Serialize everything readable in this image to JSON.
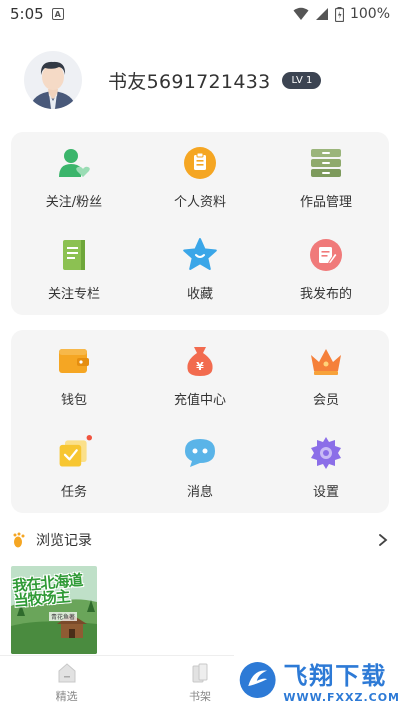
{
  "status_bar": {
    "time": "5:05",
    "battery_percent": "100%"
  },
  "profile": {
    "username": "书友5691721433",
    "level": "LV 1"
  },
  "panel_one": {
    "items": [
      {
        "label": "关注/粉丝",
        "icon": "follow-fans-icon",
        "color": "#3bb56b"
      },
      {
        "label": "个人资料",
        "icon": "profile-clipboard-icon",
        "color": "#f5a623"
      },
      {
        "label": "作品管理",
        "icon": "works-drawer-icon",
        "color": "#8faa6c"
      },
      {
        "label": "关注专栏",
        "icon": "column-notebook-icon",
        "color": "#8cc152"
      },
      {
        "label": "收藏",
        "icon": "star-icon",
        "color": "#3aa6e8"
      },
      {
        "label": "我发布的",
        "icon": "published-icon",
        "color": "#f07a7a"
      }
    ]
  },
  "panel_two": {
    "items": [
      {
        "label": "钱包",
        "icon": "wallet-icon",
        "color": "#f5a623"
      },
      {
        "label": "充值中心",
        "icon": "money-bag-icon",
        "color": "#f26b4f"
      },
      {
        "label": "会员",
        "icon": "crown-icon",
        "color": "#f5803a"
      },
      {
        "label": "任务",
        "icon": "task-icon",
        "color": "#f7c631"
      },
      {
        "label": "消息",
        "icon": "message-bubble-icon",
        "color": "#5ab4e8"
      },
      {
        "label": "设置",
        "icon": "gear-icon",
        "color": "#8b6ee8"
      }
    ]
  },
  "history": {
    "title": "浏览记录",
    "book": {
      "cover_title": "我在北海道\n当牧场主",
      "cover_author": "青花鱼著"
    }
  },
  "bottom_nav": {
    "items": [
      {
        "label": "精选",
        "icon": "home-icon"
      },
      {
        "label": "书架",
        "icon": "bookshelf-icon"
      }
    ]
  },
  "watermark": {
    "title": "飞翔下载",
    "url": "WWW.FXXZ.COM"
  }
}
